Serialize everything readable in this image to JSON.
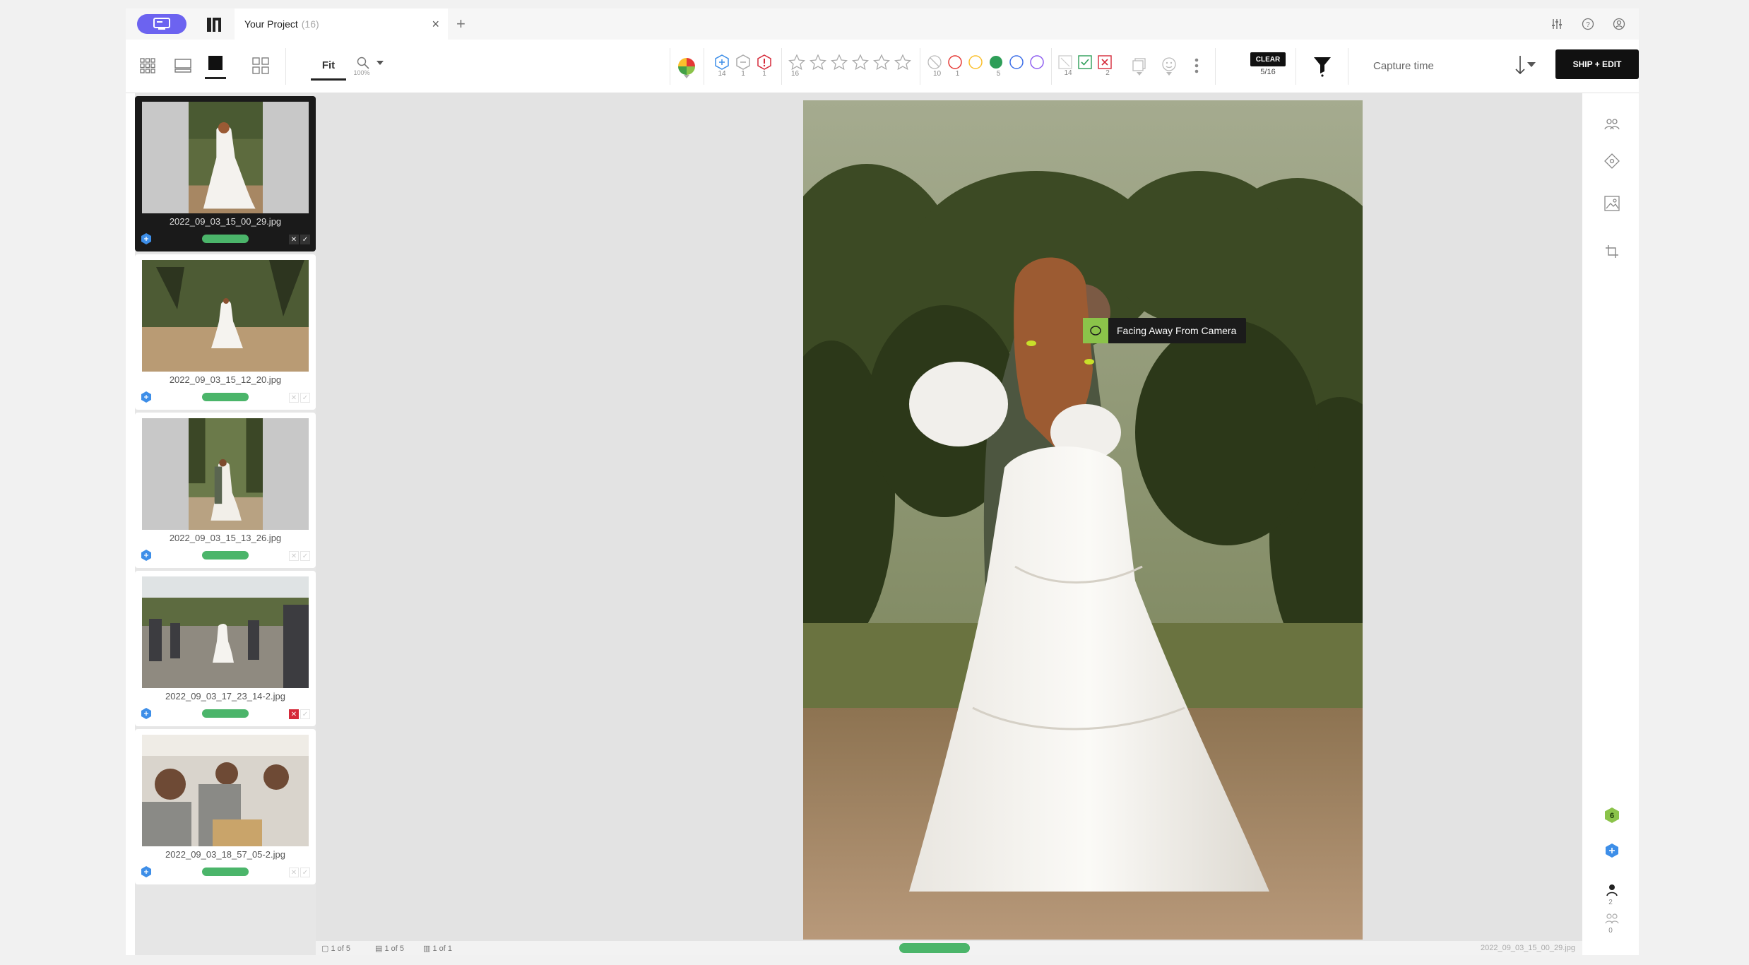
{
  "titlebar": {
    "tab_title": "Your Project",
    "tab_count": "(16)",
    "close_glyph": "×",
    "new_tab_glyph": "+",
    "icons": [
      "sliders-icon",
      "help-icon",
      "account-icon"
    ]
  },
  "toolbar": {
    "fit_label": "Fit",
    "zoom_level": "100%",
    "flag_counts": [
      "14",
      "1",
      "1"
    ],
    "star_count": "16",
    "color_counts": [
      "10",
      "1",
      "",
      "5",
      "",
      ""
    ],
    "pick_counts": [
      "14",
      "",
      "2"
    ],
    "clear_label": "CLEAR",
    "clear_count": "5/16",
    "sort_field": "Capture time",
    "ship_label": "SHIP + EDIT"
  },
  "filmstrip": {
    "items": [
      {
        "filename": "2022_09_03_15_00_29.jpg",
        "selected": true,
        "rejected": false
      },
      {
        "filename": "2022_09_03_15_12_20.jpg",
        "selected": false,
        "rejected": false
      },
      {
        "filename": "2022_09_03_15_13_26.jpg",
        "selected": false,
        "rejected": false
      },
      {
        "filename": "2022_09_03_17_23_14-2.jpg",
        "selected": false,
        "rejected": true
      },
      {
        "filename": "2022_09_03_18_57_05-2.jpg",
        "selected": false,
        "rejected": false
      }
    ]
  },
  "stage": {
    "tooltip": "Facing Away From Camera"
  },
  "statusbar": {
    "a": "1 of 5",
    "b": "1 of 5",
    "c": "1 of 1",
    "filename": "2022_09_03_15_00_29.jpg"
  },
  "rail": {
    "badge_count": "6",
    "person_count": "2",
    "group_count": "0"
  },
  "colors": {
    "accent_purple": "#6c63f0",
    "pick_green": "#4bb56a",
    "reject_red": "#d52a3a",
    "flag_blue": "#3d8ee8"
  }
}
